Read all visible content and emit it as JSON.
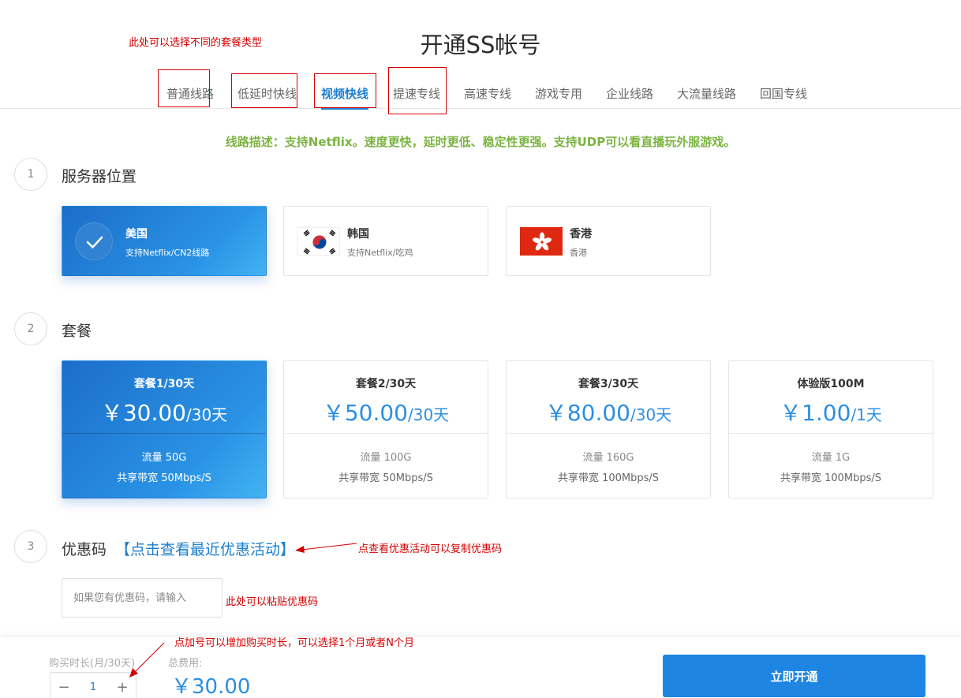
{
  "page": {
    "title": "开通SS帐号"
  },
  "tabs": [
    {
      "label": "普通线路"
    },
    {
      "label": "低延时快线"
    },
    {
      "label": "视频快线",
      "active": true
    },
    {
      "label": "提速专线"
    },
    {
      "label": "高速专线"
    },
    {
      "label": "游戏专用"
    },
    {
      "label": "企业线路"
    },
    {
      "label": "大流量线路"
    },
    {
      "label": "回国专线"
    }
  ],
  "route_description": "线路描述：支持Netflix。速度更快，延时更低、稳定性更强。支持UDP可以看直播玩外服游戏。",
  "steps": {
    "server": {
      "num": "1",
      "title": "服务器位置"
    },
    "plan": {
      "num": "2",
      "title": "套餐"
    },
    "coupon": {
      "num": "3",
      "title": "优惠码"
    }
  },
  "locations": [
    {
      "name": "美国",
      "desc": "支持Netflix/CN2线路",
      "selected": true,
      "icon": "check-icon"
    },
    {
      "name": "韩国",
      "desc": "支持Netflix/吃鸡",
      "selected": false,
      "icon": "korea-flag-icon"
    },
    {
      "name": "香港",
      "desc": "香港",
      "selected": false,
      "icon": "hongkong-flag-icon"
    }
  ],
  "plans": [
    {
      "name": "套餐1/30天",
      "price": "￥30.00",
      "period": "/30天",
      "traffic": "流量 50G",
      "bandwidth": "共享带宽 50Mbps/S",
      "selected": true
    },
    {
      "name": "套餐2/30天",
      "price": "￥50.00",
      "period": "/30天",
      "traffic": "流量 100G",
      "bandwidth": "共享带宽 50Mbps/S",
      "selected": false
    },
    {
      "name": "套餐3/30天",
      "price": "￥80.00",
      "period": "/30天",
      "traffic": "流量 160G",
      "bandwidth": "共享带宽 100Mbps/S",
      "selected": false
    },
    {
      "name": "体验版100M",
      "price": "￥1.00",
      "period": "/1天",
      "traffic": "流量 1G",
      "bandwidth": "共享带宽 100Mbps/S",
      "selected": false
    }
  ],
  "coupon": {
    "promo_link": "【点击查看最近优惠活动】",
    "placeholder": "如果您有优惠码，请输入"
  },
  "bottom": {
    "duration_label": "购买时长(月/30天)",
    "minus": "−",
    "quantity": "1",
    "plus": "+",
    "total_label": "总费用:",
    "total_value": "￥30.00",
    "buy_label": "立即开通"
  },
  "annotations": {
    "tab_types": "此处可以选择不同的套餐类型",
    "promo": "点查看优惠活动可以复制优惠码",
    "paste": "此处可以粘贴优惠码",
    "duration": "点加号可以增加购买时长，可以选择1个月或者N个月"
  },
  "colors": {
    "accent": "#1a7fd0",
    "route_desc": "#7cb342",
    "annotation": "#d40000",
    "button": "#1f85e2"
  }
}
